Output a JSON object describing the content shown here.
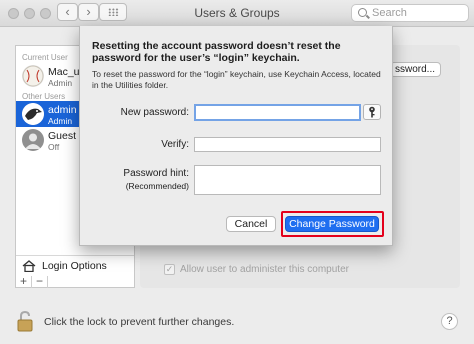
{
  "window": {
    "title": "Users & Groups",
    "search_placeholder": "Search",
    "back_glyph": "‹",
    "forward_glyph": "›"
  },
  "sidebar": {
    "current_user_label": "Current User",
    "other_users_label": "Other Users",
    "users": [
      {
        "name": "Mac_user",
        "role": "Admin",
        "selected": false,
        "avatar": "baseball-avatar"
      },
      {
        "name": "admin",
        "role": "Admin",
        "selected": true,
        "avatar": "eagle-avatar"
      },
      {
        "name": "Guest User",
        "role": "Off",
        "selected": false,
        "avatar": "guest-avatar"
      }
    ],
    "login_options_label": "Login Options",
    "add_glyph": "+",
    "remove_glyph": "−"
  },
  "background_panel": {
    "change_password_button_partial": "ssword...",
    "allow_admin_label": "Allow user to administer this computer",
    "allow_admin_checked": true
  },
  "sheet": {
    "heading": "Resetting the account password doesn’t reset the password for the user’s “login” keychain.",
    "description": "To reset the password for the “login” keychain, use Keychain Access, located in the Utilities folder.",
    "new_password_label": "New password:",
    "verify_label": "Verify:",
    "hint_label": "Password hint:",
    "hint_sublabel": "(Recommended)",
    "new_password_value": "",
    "verify_value": "",
    "hint_value": "",
    "cancel_label": "Cancel",
    "change_password_label": "Change Password"
  },
  "footer": {
    "lock_text": "Click the lock to prevent further changes.",
    "help_glyph": "?"
  },
  "colors": {
    "accent": "#1f6ef0",
    "selection": "#1a64d8",
    "highlight_box": "#e3001b"
  }
}
